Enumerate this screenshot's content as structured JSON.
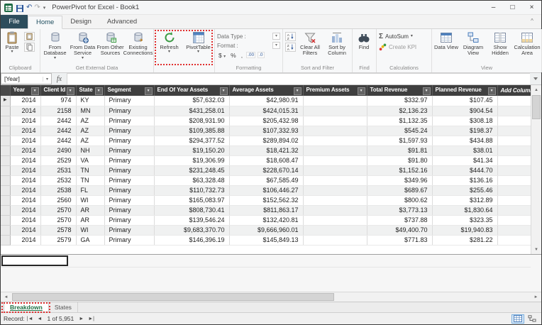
{
  "window": {
    "title": "PowerPivot for Excel - Book1",
    "controls": {
      "minimize": "–",
      "maximize": "□",
      "close": "×"
    }
  },
  "ribbon": {
    "file_tab": "File",
    "tabs": [
      "Home",
      "Design",
      "Advanced"
    ],
    "active_tab": "Home",
    "groups": {
      "clipboard": {
        "label": "Clipboard",
        "paste": "Paste"
      },
      "get_external_data": {
        "label": "Get External Data",
        "items": [
          "From Database",
          "From Data Service",
          "From Other Sources",
          "Existing Connections"
        ]
      },
      "refresh_label": "Refresh",
      "pivottable_label": "PivotTable",
      "formatting": {
        "label": "Formatting",
        "data_type": "Data Type :",
        "format": "Format :",
        "currency": "$",
        "percent": "%",
        "comma": ",",
        "increase_decimal": ".00",
        "decrease_decimal": ".0"
      },
      "sort_filter": {
        "label": "Sort and Filter",
        "clear_all_filters": "Clear All Filters",
        "sort_by_column": "Sort by Column"
      },
      "find": {
        "label": "Find",
        "find": "Find"
      },
      "calculations": {
        "label": "Calculations",
        "autosum": "AutoSum",
        "create_kpi": "Create KPI"
      },
      "view": {
        "label": "View",
        "items": [
          "Data View",
          "Diagram View",
          "Show Hidden",
          "Calculation Area"
        ]
      }
    }
  },
  "formula_bar": {
    "name_box": "[Year]",
    "fx": "fx"
  },
  "table": {
    "columns": [
      "Year",
      "Client Id",
      "State",
      "Segment",
      "End Of Year Assets",
      "Average Assets",
      "Premium Assets",
      "Total Revenue",
      "Planned Revenue"
    ],
    "add_column_label": "Add Column",
    "rows": [
      [
        "2014",
        "974",
        "KY",
        "Primary",
        "$57,632.03",
        "$42,980.91",
        "",
        "$332.97",
        "$107.45"
      ],
      [
        "2014",
        "2158",
        "MN",
        "Primary",
        "$431,258.01",
        "$424,015.31",
        "",
        "$2,136.23",
        "$904.54"
      ],
      [
        "2014",
        "2442",
        "AZ",
        "Primary",
        "$208,931.90",
        "$205,432.98",
        "",
        "$1,132.35",
        "$308.18"
      ],
      [
        "2014",
        "2442",
        "AZ",
        "Primary",
        "$109,385.88",
        "$107,332.93",
        "",
        "$545.24",
        "$198.37"
      ],
      [
        "2014",
        "2442",
        "AZ",
        "Primary",
        "$294,377.52",
        "$289,894.02",
        "",
        "$1,597.93",
        "$434.88"
      ],
      [
        "2014",
        "2490",
        "NH",
        "Primary",
        "$19,150.20",
        "$18,421.32",
        "",
        "$91.81",
        "$38.01"
      ],
      [
        "2014",
        "2529",
        "VA",
        "Primary",
        "$19,306.99",
        "$18,608.47",
        "",
        "$91.80",
        "$41.34"
      ],
      [
        "2014",
        "2531",
        "TN",
        "Primary",
        "$231,248.45",
        "$228,670.14",
        "",
        "$1,152.16",
        "$444.70"
      ],
      [
        "2014",
        "2532",
        "TN",
        "Primary",
        "$63,328.48",
        "$67,585.49",
        "",
        "$349.96",
        "$136.16"
      ],
      [
        "2014",
        "2538",
        "FL",
        "Primary",
        "$110,732.73",
        "$106,446.27",
        "",
        "$689.67",
        "$255.46"
      ],
      [
        "2014",
        "2560",
        "WI",
        "Primary",
        "$165,083.97",
        "$152,562.32",
        "",
        "$800.62",
        "$312.89"
      ],
      [
        "2014",
        "2570",
        "AR",
        "Primary",
        "$808,730.41",
        "$811,863.17",
        "",
        "$3,773.13",
        "$1,830.64"
      ],
      [
        "2014",
        "2570",
        "AR",
        "Primary",
        "$139,546.24",
        "$132,420.81",
        "",
        "$737.88",
        "$323.35"
      ],
      [
        "2014",
        "2578",
        "WI",
        "Primary",
        "$9,683,370.70",
        "$9,666,960.01",
        "",
        "$49,400.70",
        "$19,940.83"
      ],
      [
        "2014",
        "2579",
        "GA",
        "Primary",
        "$146,396.19",
        "$145,849.13",
        "",
        "$771.83",
        "$281.22"
      ]
    ]
  },
  "sheet_tabs": [
    "Breakdown",
    "States"
  ],
  "status_bar": {
    "record_label": "Record:",
    "record_value": "1 of 5,951"
  },
  "colors": {
    "annotation_red": "#e03030",
    "active_sheet_green": "#1e7145",
    "header_bg": "#3f3f3f",
    "file_tab_bg": "#2d4d5c"
  }
}
